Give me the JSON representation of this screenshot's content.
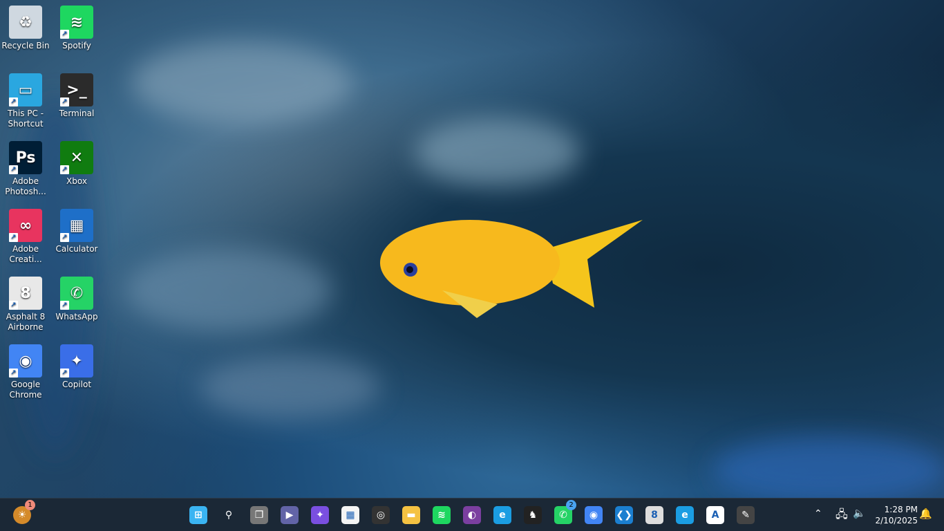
{
  "desktop": {
    "icons": [
      {
        "label": "Recycle Bin",
        "icon": "recycle-bin-icon",
        "color": "#cfd8e0",
        "glyph": "♻",
        "shortcut": false
      },
      {
        "label": "Spotify",
        "icon": "spotify-icon",
        "color": "#1ed760",
        "glyph": "≋",
        "shortcut": true
      },
      {
        "label": "This PC - Shortcut",
        "icon": "computer-icon",
        "color": "#2aa7e0",
        "glyph": "▭",
        "shortcut": true
      },
      {
        "label": "Terminal",
        "icon": "terminal-icon",
        "color": "#2b2b2b",
        "glyph": ">_",
        "shortcut": true
      },
      {
        "label": "Adobe Photosh...",
        "icon": "photoshop-icon",
        "color": "#001e36",
        "glyph": "Ps",
        "shortcut": true
      },
      {
        "label": "Xbox",
        "icon": "xbox-icon",
        "color": "#107c10",
        "glyph": "✕",
        "shortcut": true
      },
      {
        "label": "Adobe Creati...",
        "icon": "creative-cloud-icon",
        "color": "#e8345f",
        "glyph": "∞",
        "shortcut": true
      },
      {
        "label": "Calculator",
        "icon": "calculator-icon",
        "color": "#1e6fc8",
        "glyph": "▦",
        "shortcut": true
      },
      {
        "label": "Asphalt 8 Airborne",
        "icon": "asphalt-icon",
        "color": "#e8e8e8",
        "glyph": "8",
        "shortcut": true
      },
      {
        "label": "WhatsApp",
        "icon": "whatsapp-icon",
        "color": "#25d366",
        "glyph": "✆",
        "shortcut": true
      },
      {
        "label": "Google Chrome",
        "icon": "chrome-icon",
        "color": "#4285f4",
        "glyph": "◉",
        "shortcut": true
      },
      {
        "label": "Copilot",
        "icon": "copilot-icon",
        "color": "#3a6ee8",
        "glyph": "✦",
        "shortcut": true
      }
    ]
  },
  "taskbar": {
    "widget_badge": "1",
    "apps": [
      {
        "name": "start-button",
        "color": "#3ab4f2",
        "glyph": "⊞"
      },
      {
        "name": "search-button",
        "color": "transparent",
        "glyph": "⚲"
      },
      {
        "name": "task-view-button",
        "color": "#777",
        "glyph": "❐"
      },
      {
        "name": "teams-meet-button",
        "color": "#6264a7",
        "glyph": "▶"
      },
      {
        "name": "copilot-button",
        "color": "#7a4fe0",
        "glyph": "✦"
      },
      {
        "name": "microsoft-store-button",
        "color": "#f4f4f4",
        "glyph": "▦"
      },
      {
        "name": "obs-button",
        "color": "#333",
        "glyph": "◎"
      },
      {
        "name": "file-explorer-button",
        "color": "#f5c242",
        "glyph": "▬"
      },
      {
        "name": "spotify-button",
        "color": "#1ed760",
        "glyph": "≋"
      },
      {
        "name": "github-button",
        "color": "#7b3fa0",
        "glyph": "◐"
      },
      {
        "name": "edge-profile-button",
        "color": "#1b9de2",
        "glyph": "e"
      },
      {
        "name": "game-button",
        "color": "#222",
        "glyph": "♞"
      },
      {
        "name": "whatsapp-button",
        "color": "#25d366",
        "glyph": "✆",
        "badge": "2"
      },
      {
        "name": "chrome-button",
        "color": "#4285f4",
        "glyph": "◉"
      },
      {
        "name": "vscode-button",
        "color": "#1b7fd0",
        "glyph": "❮❯"
      },
      {
        "name": "asphalt-button",
        "color": "#ddd",
        "glyph": "8"
      },
      {
        "name": "edge-button",
        "color": "#1b9de2",
        "glyph": "e"
      },
      {
        "name": "app-a-button",
        "color": "#fff",
        "glyph": "A"
      },
      {
        "name": "notes-app-button",
        "color": "#444",
        "glyph": "✎"
      }
    ],
    "time": "1:28 PM",
    "date": "2/10/2025"
  }
}
